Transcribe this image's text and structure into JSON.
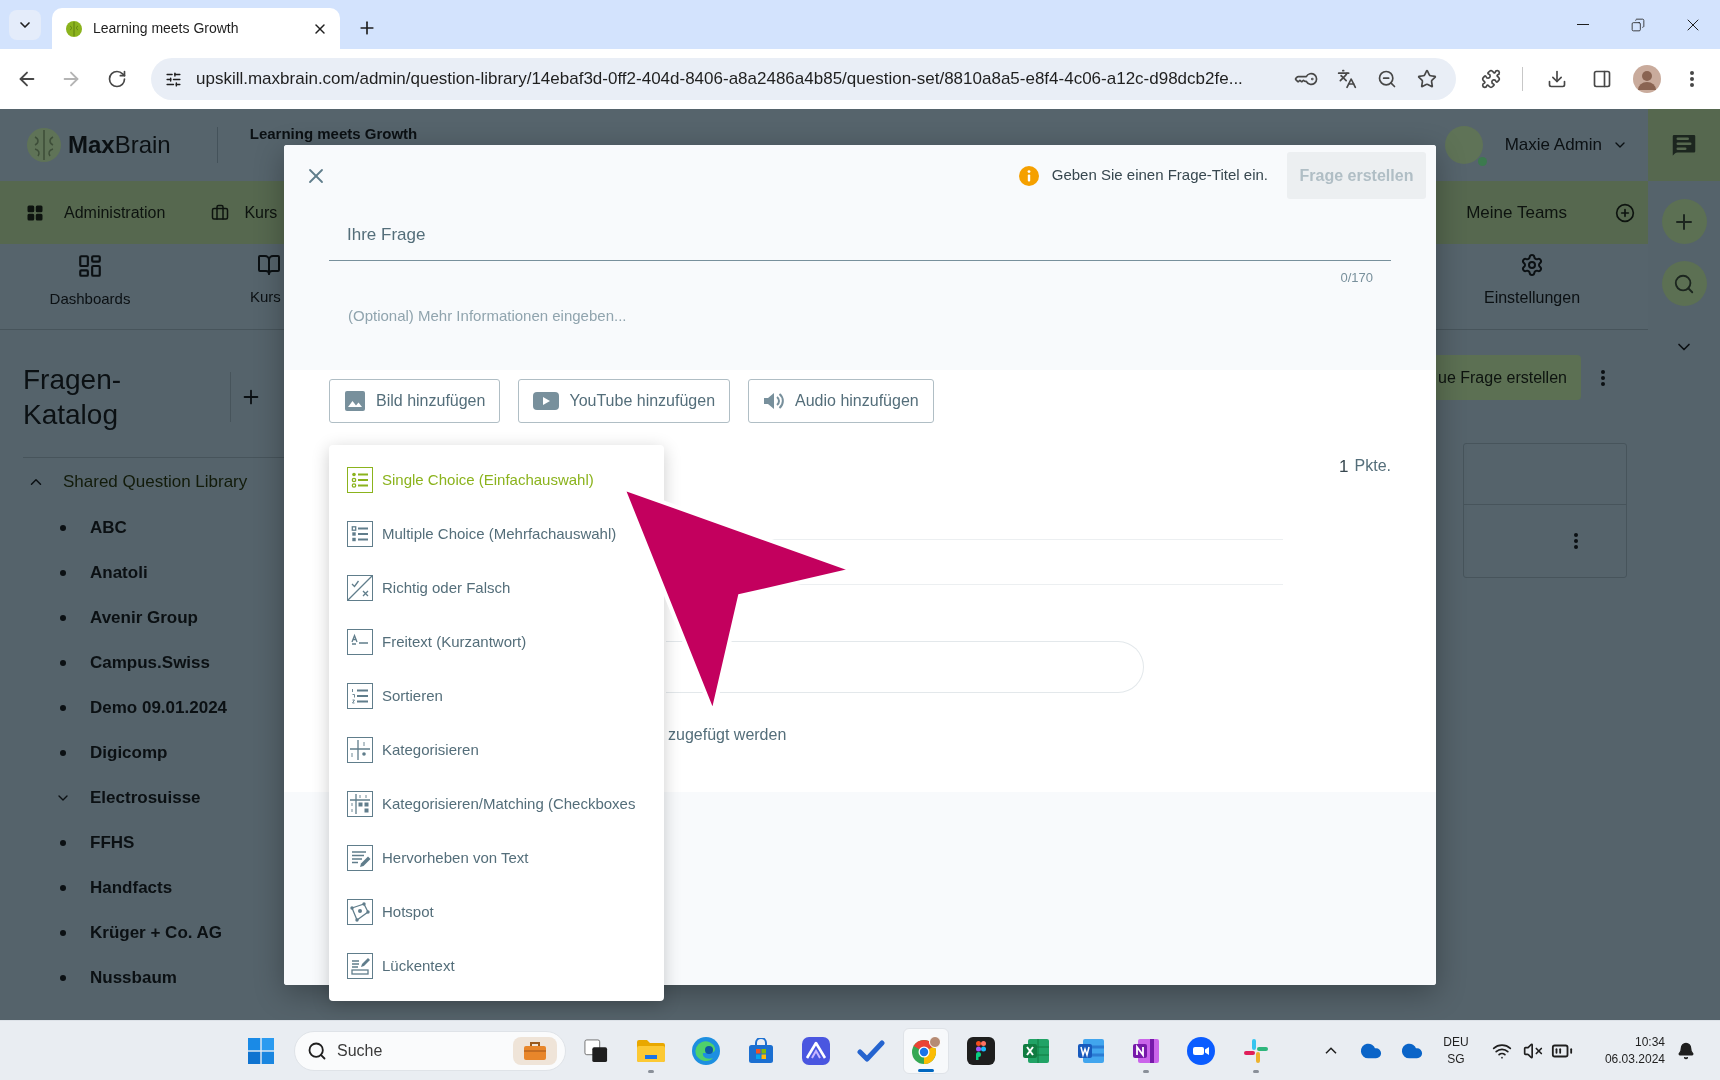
{
  "browser": {
    "tab": {
      "title": "Learning meets Growth"
    },
    "forward_disabled": true,
    "url": "upskill.maxbrain.com/admin/question-library/14ebaf3d-0ff2-404d-8406-a8a2486a4b85/question-set/8810a8a5-e8f4-4c06-a12c-d98dcb2fe..."
  },
  "app": {
    "header": {
      "logo": "**Max**Brain",
      "organization": "Learning meets Growth",
      "user": {
        "name": "Maxie Admin",
        "online": true
      }
    },
    "nav_bar": {
      "left": [
        {
          "label": "Administration",
          "kind": "grid"
        },
        {
          "label": "Kurs",
          "kind": "briefcase"
        }
      ],
      "right": [
        {
          "label": "Meine Teams",
          "kind": "add"
        }
      ]
    },
    "icon_nav": {
      "left": [
        {
          "label": "Dashboards",
          "kind": "dashboard"
        },
        {
          "label": "Kurs",
          "kind": "course"
        }
      ],
      "right": [
        {
          "label": "Einstellungen",
          "kind": "settings"
        }
      ]
    },
    "sidebar": {
      "title": "Fragen-Katalog",
      "library": {
        "title": "Shared Question Library",
        "expanded": true,
        "items": [
          {
            "label": "ABC",
            "kind": "leaf"
          },
          {
            "label": "Anatoli",
            "kind": "leaf"
          },
          {
            "label": "Avenir Group",
            "kind": "leaf"
          },
          {
            "label": "Campus.Swiss",
            "kind": "leaf"
          },
          {
            "label": "Demo 09.01.2024",
            "kind": "leaf"
          },
          {
            "label": "Digicomp",
            "kind": "leaf"
          },
          {
            "label": "Electrosuisse",
            "kind": "group"
          },
          {
            "label": "FFHS",
            "kind": "leaf"
          },
          {
            "label": "Handfacts",
            "kind": "leaf"
          },
          {
            "label": "Krüger + Co. AG",
            "kind": "leaf"
          },
          {
            "label": "Nussbaum",
            "kind": "leaf"
          }
        ]
      }
    },
    "content": {
      "create_button": "ue Frage erstellen"
    }
  },
  "modal": {
    "hint": "Geben Sie einen Frage-Titel ein.",
    "submit_button": {
      "label": "Frage erstellen",
      "disabled": true
    },
    "title_field": {
      "placeholder": "Ihre Frage",
      "counter": "0/170"
    },
    "description_field": {
      "placeholder": "(Optional) Mehr Informationen eingeben..."
    },
    "media_buttons": [
      {
        "label": "Bild hinzufügen",
        "kind": "image"
      },
      {
        "label": "YouTube hinzufügen",
        "kind": "video"
      },
      {
        "label": "Audio hinzufügen",
        "kind": "audio"
      }
    ],
    "points": {
      "value": "1",
      "unit": "Pkte."
    },
    "partial_text": "zugefügt werden"
  },
  "question_types": [
    {
      "label": "Single Choice (Einfachauswahl)",
      "kind": "single_choice",
      "selected": true
    },
    {
      "label": "Multiple Choice (Mehrfachauswahl)",
      "kind": "multiple_choice",
      "selected": false
    },
    {
      "label": "Richtig oder Falsch",
      "kind": "true_false",
      "selected": false
    },
    {
      "label": "Freitext (Kurzantwort)",
      "kind": "free_text",
      "selected": false
    },
    {
      "label": "Sortieren",
      "kind": "sort",
      "selected": false
    },
    {
      "label": "Kategorisieren",
      "kind": "categorize",
      "selected": false
    },
    {
      "label": "Kategorisieren/Matching (Checkboxes",
      "kind": "matching",
      "selected": false
    },
    {
      "label": "Hervorheben von Text",
      "kind": "highlight",
      "selected": false
    },
    {
      "label": "Hotspot",
      "kind": "hotspot",
      "selected": false
    },
    {
      "label": "Lückentext",
      "kind": "cloze",
      "selected": false
    }
  ],
  "taskbar": {
    "search": {
      "label": "Suche"
    },
    "apps": [
      {
        "kind": "task_view",
        "running": false,
        "selected": false
      },
      {
        "kind": "folder",
        "running": true,
        "selected": false
      },
      {
        "kind": "swirl",
        "running": false,
        "selected": false
      },
      {
        "kind": "bag",
        "running": false,
        "selected": false
      },
      {
        "kind": "peak",
        "running": false,
        "selected": false
      },
      {
        "kind": "check",
        "running": false,
        "selected": false
      },
      {
        "kind": "ring",
        "running": true,
        "selected": true
      },
      {
        "kind": "shapes",
        "running": false,
        "selected": false
      },
      {
        "kind": "spreadsheet",
        "running": false,
        "selected": false
      },
      {
        "kind": "document",
        "running": false,
        "selected": false
      },
      {
        "kind": "notebook",
        "running": true,
        "selected": false
      },
      {
        "kind": "camera",
        "running": false,
        "selected": false
      },
      {
        "kind": "pinwheel",
        "running": true,
        "selected": false
      }
    ],
    "tray": {
      "language": "DEU",
      "region": "SG"
    },
    "clock": {
      "time": "10:34",
      "date": "06.03.2024"
    }
  }
}
